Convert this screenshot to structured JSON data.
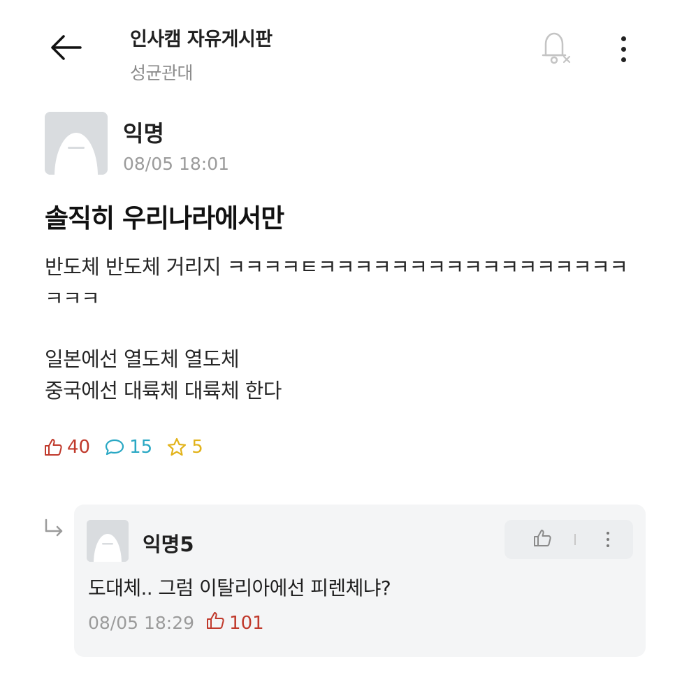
{
  "header": {
    "board_title": "인사캠 자유게시판",
    "school": "성균관대",
    "icons": {
      "back": "arrow-left-icon",
      "notify": "bell-off-icon",
      "more": "more-vertical-icon"
    }
  },
  "post": {
    "author": "익명",
    "time": "08/05 18:01",
    "title": "솔직히 우리나라에서만",
    "body_line1": "반도체 반도체 거리지 ㅋㅋㅋㅋㅌㅋㅋㅋㅋㅋㅋㅋㅋㅋㅋㅋㅋㅋㅋㅋㅋㅋㅋㅋㅋ",
    "body_line2": "일본에선 열도체 열도체",
    "body_line3": "중국에선 대륙체 대륙체 한다",
    "stats": {
      "likes": "40",
      "comments": "15",
      "scraps": "5"
    }
  },
  "comment": {
    "author": "익명5",
    "text": "도대체.. 그럼 이탈리아에선 피렌체냐?",
    "time": "08/05 18:29",
    "likes": "101"
  },
  "colors": {
    "like": "#c0392b",
    "comment": "#2aa8c4",
    "scrap": "#e2b31b",
    "card_bg": "#f4f5f6"
  }
}
